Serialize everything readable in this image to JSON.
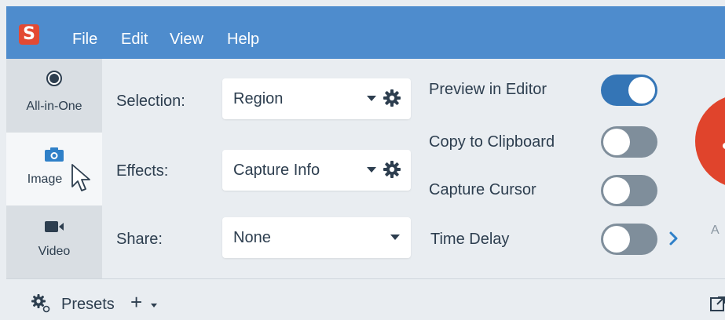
{
  "app": {
    "logo_letter": "S",
    "menu": [
      "File",
      "Edit",
      "View",
      "Help"
    ]
  },
  "modes": [
    {
      "label": "All-in-One",
      "icon": "record-circle-icon",
      "state": "inactive"
    },
    {
      "label": "Image",
      "icon": "camera-icon",
      "state": "active"
    },
    {
      "label": "Video",
      "icon": "video-camera-icon",
      "state": "inactive"
    }
  ],
  "settings": {
    "selection": {
      "label": "Selection:",
      "value": "Region"
    },
    "effects": {
      "label": "Effects:",
      "value": "Capture Info"
    },
    "share": {
      "label": "Share:",
      "value": "None"
    }
  },
  "options": [
    {
      "label": "Preview in Editor",
      "on": true
    },
    {
      "label": "Copy to Clipboard",
      "on": false
    },
    {
      "label": "Capture Cursor",
      "on": false
    },
    {
      "label": "Time Delay",
      "on": false
    }
  ],
  "capture": {
    "label_partial": "A"
  },
  "bottom": {
    "presets_label": "Presets",
    "add_symbol": "+"
  },
  "colors": {
    "menubar": "#4e8ccd",
    "logo": "#e34a34",
    "toggle_on": "#3475b6",
    "toggle_off": "#7f8e9b",
    "record": "#e0442c",
    "accent_chevron": "#2f80c8"
  }
}
